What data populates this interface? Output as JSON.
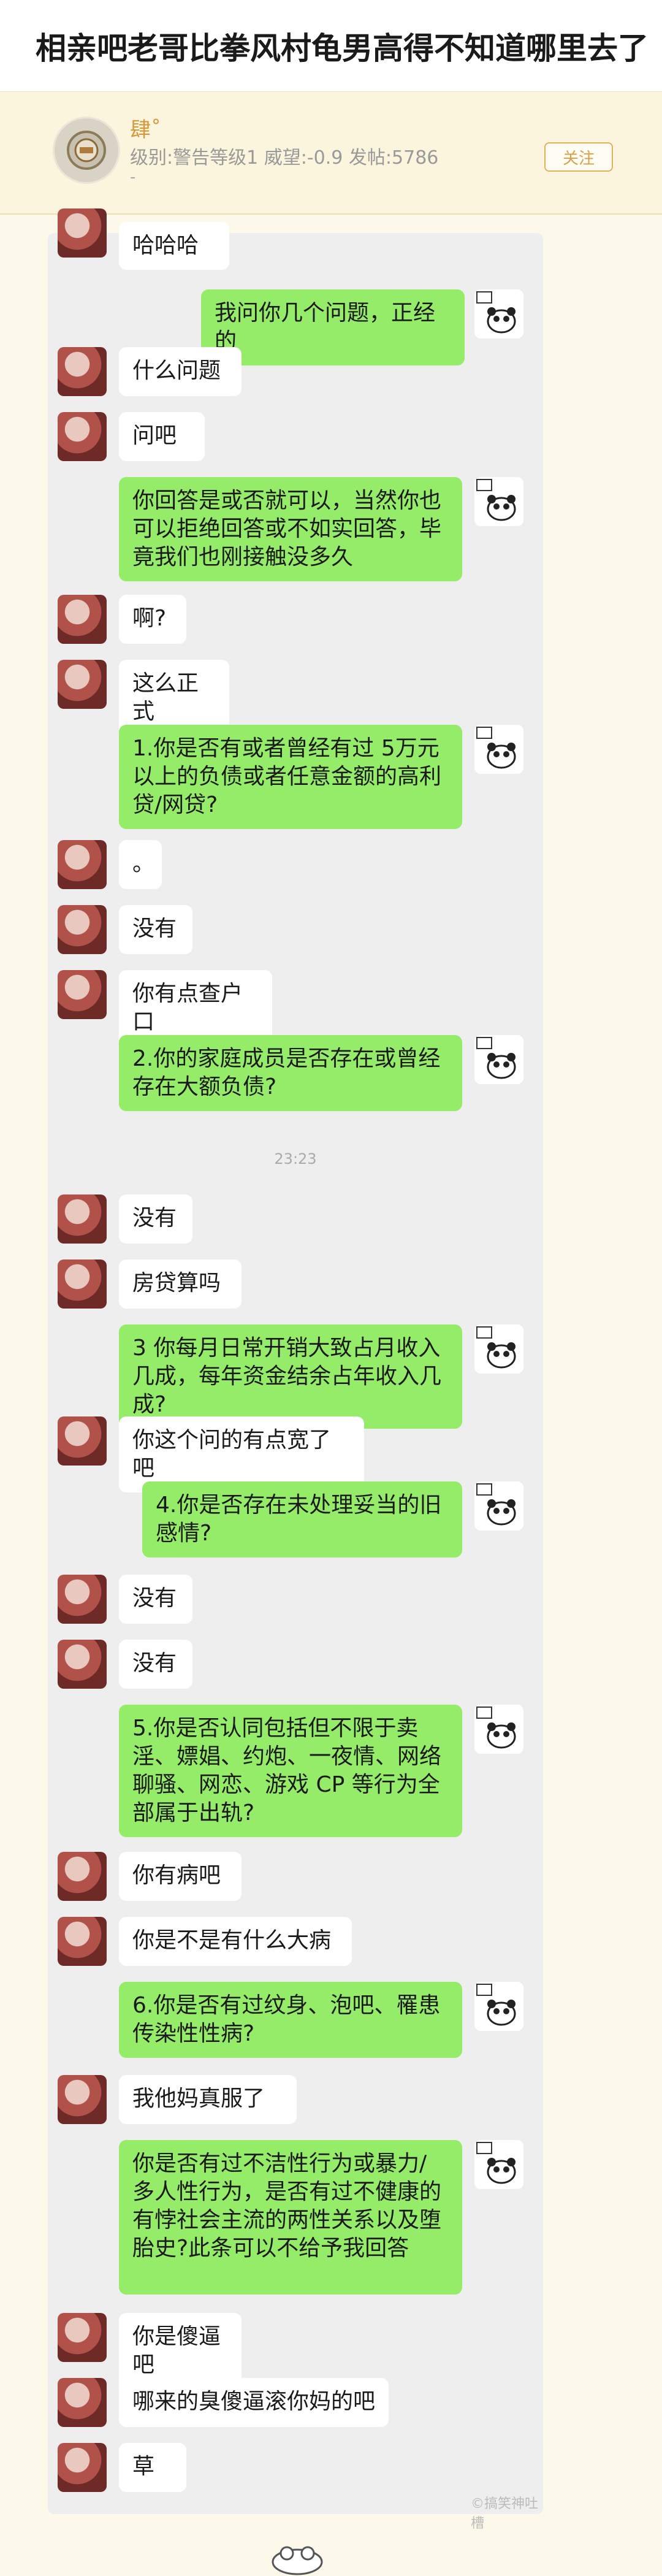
{
  "header": {
    "title": "相亲吧老哥比拳风村龟男高得不知道哪里去了"
  },
  "user": {
    "name": "肆˚",
    "meta": "级别:警告等级1 威望:-0.9 发帖:5786",
    "dash": "-",
    "follow_label": "关注"
  },
  "chat": {
    "timestamp": "23:23",
    "watermark": "©搞笑神吐槽",
    "messages": [
      {
        "dir": "in",
        "text": "哈哈哈"
      },
      {
        "dir": "out",
        "text": "我问你几个问题，正经的"
      },
      {
        "dir": "in",
        "text": "什么问题"
      },
      {
        "dir": "in",
        "text": "问吧"
      },
      {
        "dir": "out",
        "text": "你回答是或否就可以，当然你也可以拒绝回答或不如实回答，毕竟我们也刚接触没多久"
      },
      {
        "dir": "in",
        "text": "啊?"
      },
      {
        "dir": "in",
        "text": "这么正式"
      },
      {
        "dir": "out",
        "text": "1.你是否有或者曾经有过 5万元以上的负债或者任意金额的高利贷/网贷?"
      },
      {
        "dir": "in",
        "text": "。"
      },
      {
        "dir": "in",
        "text": "没有"
      },
      {
        "dir": "in",
        "text": "你有点查户口"
      },
      {
        "dir": "out",
        "text": "2.你的家庭成员是否存在或曾经存在大额负债?"
      },
      {
        "dir": "in",
        "text": "没有"
      },
      {
        "dir": "in",
        "text": "房贷算吗"
      },
      {
        "dir": "out",
        "text": "3 你每月日常开销大致占月收入几成，每年资金结余占年收入几成?"
      },
      {
        "dir": "in",
        "text": "你这个问的有点宽了吧"
      },
      {
        "dir": "out",
        "text": "4.你是否存在未处理妥当的旧感情?"
      },
      {
        "dir": "in",
        "text": "没有"
      },
      {
        "dir": "in",
        "text": "没有"
      },
      {
        "dir": "out",
        "text": "5.你是否认同包括但不限于卖淫、嫖娼、约炮、一夜情、网络聊骚、网恋、游戏 CP 等行为全部属于出轨?"
      },
      {
        "dir": "in",
        "text": "你有病吧"
      },
      {
        "dir": "in",
        "text": "你是不是有什么大病"
      },
      {
        "dir": "out",
        "text": "6.你是否有过纹身、泡吧、罹患传染性性病?"
      },
      {
        "dir": "in",
        "text": "我他妈真服了"
      },
      {
        "dir": "out",
        "text": "你是否有过不洁性行为或暴力/多人性行为，是否有过不健康的有悖社会主流的两性关系以及堕胎史?此条可以不给予我回答"
      },
      {
        "dir": "in",
        "text": "你是傻逼吧"
      },
      {
        "dir": "in",
        "text": "哪来的臭傻逼滚你妈的吧"
      },
      {
        "dir": "in",
        "text": "草"
      }
    ]
  }
}
